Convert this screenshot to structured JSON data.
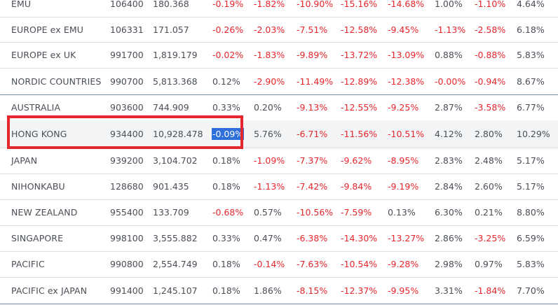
{
  "rows": [
    {
      "name": "EMU",
      "code": "106400",
      "value": "180.368",
      "changes": [
        "-0.19%",
        "-1.82%",
        "-10.90%",
        "-15.16%",
        "-14.68%",
        "1.00%",
        "-1.10%",
        "4.64%"
      ]
    },
    {
      "name": "EUROPE ex EMU",
      "code": "106331",
      "value": "171.057",
      "changes": [
        "-0.26%",
        "-2.03%",
        "-7.51%",
        "-12.58%",
        "-9.45%",
        "-1.13%",
        "-2.58%",
        "6.18%"
      ]
    },
    {
      "name": "EUROPE ex UK",
      "code": "991700",
      "value": "1,819.179",
      "changes": [
        "-0.02%",
        "-1.83%",
        "-9.89%",
        "-13.72%",
        "-13.09%",
        "0.88%",
        "-0.88%",
        "5.83%"
      ]
    },
    {
      "name": "NORDIC COUNTRIES",
      "code": "990700",
      "value": "5,813.368",
      "changes": [
        "0.12%",
        "-2.90%",
        "-11.49%",
        "-12.89%",
        "-12.38%",
        "-0.00%",
        "-0.94%",
        "8.67%"
      ]
    },
    {
      "name": "AUSTRALIA",
      "code": "903600",
      "value": "744.909",
      "changes": [
        "0.33%",
        "0.20%",
        "-9.13%",
        "-12.55%",
        "-9.25%",
        "2.87%",
        "-3.58%",
        "6.77%"
      ]
    },
    {
      "name": "HONG KONG",
      "code": "934400",
      "value": "10,928.478",
      "changes": [
        "-0.09%",
        "5.76%",
        "-6.71%",
        "-11.56%",
        "-10.51%",
        "4.12%",
        "2.80%",
        "10.29%"
      ]
    },
    {
      "name": "JAPAN",
      "code": "939200",
      "value": "3,104.702",
      "changes": [
        "0.18%",
        "-1.09%",
        "-7.37%",
        "-9.62%",
        "-8.95%",
        "2.83%",
        "2.48%",
        "5.17%"
      ]
    },
    {
      "name": "NIHONKABU",
      "code": "128680",
      "value": "901.435",
      "changes": [
        "0.18%",
        "-1.13%",
        "-7.42%",
        "-9.84%",
        "-9.19%",
        "2.84%",
        "2.60%",
        "5.17%"
      ]
    },
    {
      "name": "NEW ZEALAND",
      "code": "955400",
      "value": "133.709",
      "changes": [
        "-0.68%",
        "0.57%",
        "-10.56%",
        "-7.59%",
        "0.13%",
        "6.30%",
        "0.21%",
        "8.80%"
      ]
    },
    {
      "name": "SINGAPORE",
      "code": "998100",
      "value": "3,555.882",
      "changes": [
        "0.33%",
        "0.47%",
        "-6.38%",
        "-14.30%",
        "-13.27%",
        "2.86%",
        "-3.25%",
        "6.59%"
      ]
    },
    {
      "name": "PACIFIC",
      "code": "990800",
      "value": "2,554.749",
      "changes": [
        "0.18%",
        "-0.14%",
        "-7.63%",
        "-10.54%",
        "-9.28%",
        "2.98%",
        "0.97%",
        "5.83%"
      ]
    },
    {
      "name": "PACIFIC ex JAPAN",
      "code": "991400",
      "value": "1,245.107",
      "changes": [
        "0.18%",
        "1.86%",
        "-8.15%",
        "-12.37%",
        "-9.95%",
        "3.31%",
        "-1.84%",
        "7.70%"
      ]
    }
  ],
  "selection": {
    "row_index": 5,
    "column_index": 0
  },
  "colors": {
    "negative": "#e8262c",
    "text": "#4a4e57",
    "highlight_border": "#e5262c",
    "selection_bg": "#2f6fdc"
  }
}
